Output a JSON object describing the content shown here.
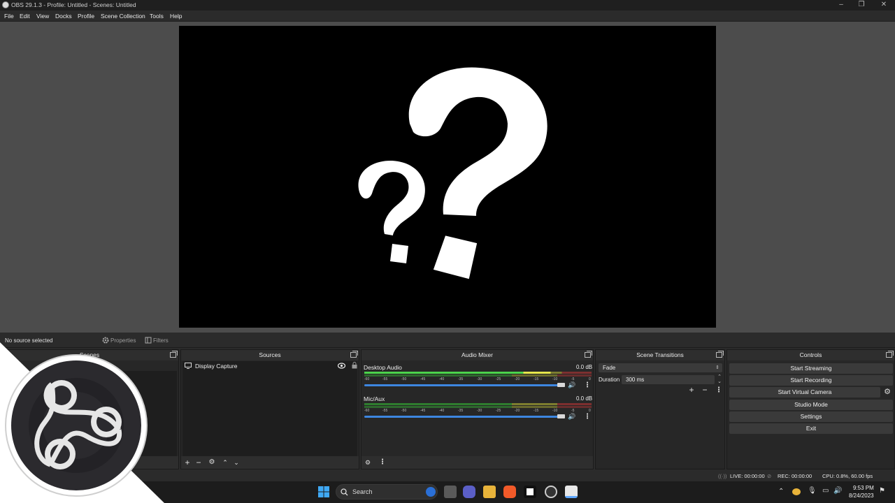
{
  "window": {
    "title": "OBS 29.1.3 - Profile: Untitled - Scenes: Untitled"
  },
  "menu": [
    "File",
    "Edit",
    "View",
    "Docks",
    "Profile",
    "Scene Collection",
    "Tools",
    "Help"
  ],
  "context_bar": {
    "selection": "No source selected",
    "properties": "Properties",
    "filters": "Filters"
  },
  "docks": {
    "scenes": {
      "title": "Scenes"
    },
    "sources": {
      "title": "Sources",
      "items": [
        {
          "name": "Display Capture",
          "visible": true,
          "locked": false
        }
      ]
    },
    "audio_mixer": {
      "title": "Audio Mixer",
      "channels": [
        {
          "name": "Desktop Audio",
          "level": "0.0 dB"
        },
        {
          "name": "Mic/Aux",
          "level": "0.0 dB"
        }
      ],
      "ticks": [
        "-60",
        "-55",
        "-50",
        "-45",
        "-40",
        "-35",
        "-30",
        "-25",
        "-20",
        "-15",
        "-10",
        "-5",
        "0"
      ]
    },
    "transitions": {
      "title": "Scene Transitions",
      "transition": "Fade",
      "duration_label": "Duration",
      "duration": "300 ms"
    },
    "controls": {
      "title": "Controls",
      "buttons": [
        "Start Streaming",
        "Start Recording",
        "Start Virtual Camera",
        "Studio Mode",
        "Settings",
        "Exit"
      ]
    }
  },
  "status": {
    "live": "LIVE: 00:00:00",
    "rec": "REC: 00:00:00",
    "cpu": "CPU: 0.8%, 60.00 fps"
  },
  "taskbar": {
    "search": "Search",
    "time": "9:53 PM",
    "date": "8/24/2023"
  },
  "colors": {
    "meter_green": "#4bd34b",
    "meter_yellow": "#e6e64b",
    "meter_red": "#d34b4b",
    "slider_blue": "#3d86e0"
  }
}
